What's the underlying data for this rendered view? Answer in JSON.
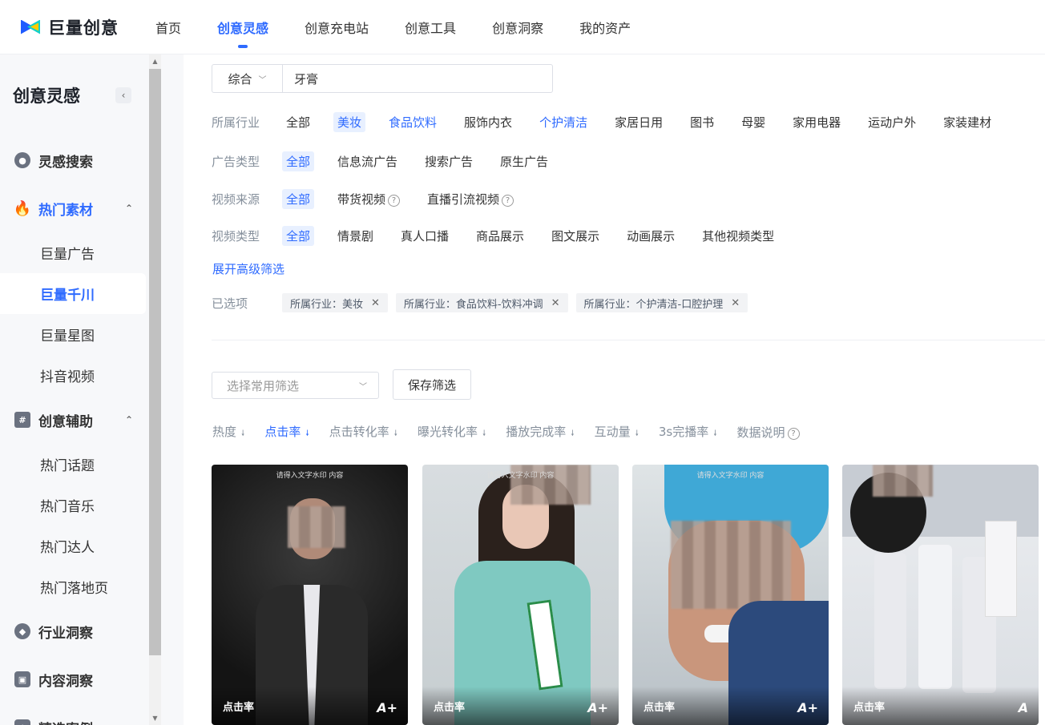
{
  "header": {
    "logo_text": "巨量创意",
    "nav": [
      {
        "label": "首页",
        "active": false
      },
      {
        "label": "创意灵感",
        "active": true
      },
      {
        "label": "创意充电站",
        "active": false
      },
      {
        "label": "创意工具",
        "active": false
      },
      {
        "label": "创意洞察",
        "active": false
      },
      {
        "label": "我的资产",
        "active": false
      }
    ]
  },
  "sidebar": {
    "title": "创意灵感",
    "collapse_icon": "‹",
    "groups": [
      {
        "label": "灵感搜索",
        "icon": "search-icon",
        "active": false
      },
      {
        "label": "热门素材",
        "icon": "flame-icon",
        "active": true,
        "children": [
          "巨量广告",
          "巨量千川",
          "巨量星图",
          "抖音视频"
        ],
        "active_child": "巨量千川"
      },
      {
        "label": "创意辅助",
        "icon": "hash-icon",
        "active": false,
        "children": [
          "热门话题",
          "热门音乐",
          "热门达人",
          "热门落地页"
        ]
      },
      {
        "label": "行业洞察",
        "icon": "compass-icon",
        "active": false
      },
      {
        "label": "内容洞察",
        "icon": "content-icon",
        "active": false
      },
      {
        "label": "精选案例",
        "icon": "star-icon",
        "active": false
      }
    ]
  },
  "search": {
    "type": "综合",
    "query": "牙膏"
  },
  "filters": {
    "industry": {
      "label": "所属行业",
      "options": [
        "全部",
        "美妆",
        "食品饮料",
        "服饰内衣",
        "个护清洁",
        "家居日用",
        "图书",
        "母婴",
        "家用电器",
        "运动户外",
        "家装建材"
      ],
      "selected": "美妆",
      "highlighted": [
        "食品饮料",
        "个护清洁"
      ]
    },
    "ad_type": {
      "label": "广告类型",
      "options": [
        "全部",
        "信息流广告",
        "搜索广告",
        "原生广告"
      ],
      "selected": "全部"
    },
    "video_source": {
      "label": "视频来源",
      "options": [
        "全部",
        "带货视频",
        "直播引流视频"
      ],
      "selected": "全部"
    },
    "video_type": {
      "label": "视频类型",
      "options": [
        "全部",
        "情景剧",
        "真人口播",
        "商品展示",
        "图文展示",
        "动画展示",
        "其他视频类型"
      ],
      "selected": "全部"
    },
    "expand_label": "展开高级筛选",
    "selected_label": "已选项",
    "selected_tags": [
      "所属行业：美妆",
      "所属行业：食品饮料-饮料冲调",
      "所属行业：个护清洁-口腔护理"
    ]
  },
  "toolbar": {
    "preset_placeholder": "选择常用筛选",
    "save_label": "保存筛选"
  },
  "sort": {
    "items": [
      "热度",
      "点击率",
      "点击转化率",
      "曝光转化率",
      "播放完成率",
      "互动量",
      "3s完播率"
    ],
    "active": "点击率",
    "help_label": "数据说明"
  },
  "cards": [
    {
      "caption": "请得入文字水印 内容",
      "metric": "点击率",
      "grade": "A+"
    },
    {
      "caption": "请得入文字水印 内容",
      "metric": "点击率",
      "grade": "A+"
    },
    {
      "caption": "请得入文字水印 内容",
      "metric": "点击率",
      "grade": "A+"
    },
    {
      "caption": "",
      "metric": "点击率",
      "grade": "A"
    }
  ]
}
